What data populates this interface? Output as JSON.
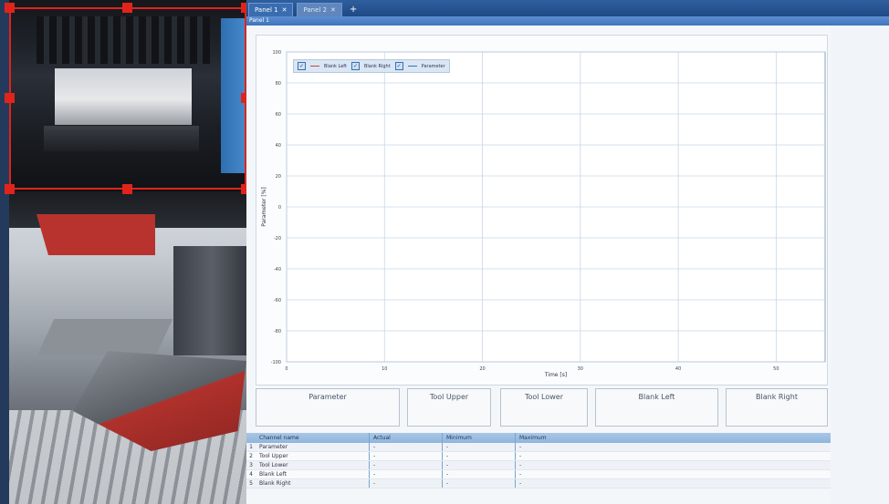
{
  "tabs": [
    {
      "label": "Panel 1",
      "active": true
    },
    {
      "label": "Panel 2",
      "active": false
    }
  ],
  "subbar_label": "Panel 1",
  "legend": {
    "items": [
      "Blank Left",
      "Blank Right",
      "Parameter"
    ]
  },
  "chart_data": {
    "type": "line",
    "ylabel": "Parameter [%]",
    "xlabel": "Time [s]",
    "yticks": [
      "100",
      "80",
      "60",
      "40",
      "20",
      "0",
      "-20",
      "-40",
      "-60",
      "-80",
      "-100"
    ],
    "xticks": [
      "0",
      "10",
      "20",
      "30",
      "40",
      "50"
    ],
    "ylim": [
      -100,
      100
    ],
    "xlim": [
      0,
      55
    ],
    "grid": true,
    "series": []
  },
  "indicators": [
    "Parameter",
    "Tool Upper",
    "Tool Lower",
    "Blank Left",
    "Blank Right"
  ],
  "table": {
    "headers": [
      "Channel name",
      "Actual",
      "Minimum",
      "Maximum"
    ],
    "rows": [
      {
        "idx": "1",
        "name": "Parameter",
        "actual": "-",
        "min": "-",
        "max": "-"
      },
      {
        "idx": "2",
        "name": "Tool Upper",
        "actual": "-",
        "min": "-",
        "max": "-"
      },
      {
        "idx": "3",
        "name": "Tool Lower",
        "actual": "-",
        "min": "-",
        "max": "-"
      },
      {
        "idx": "4",
        "name": "Blank Left",
        "actual": "-",
        "min": "-",
        "max": "-"
      },
      {
        "idx": "5",
        "name": "Blank Right",
        "actual": "-",
        "min": "-",
        "max": "-"
      }
    ]
  },
  "colors": {
    "selection": "#e0241b",
    "titlebar": "#1e4a86",
    "grid": "#c9d6e6"
  }
}
